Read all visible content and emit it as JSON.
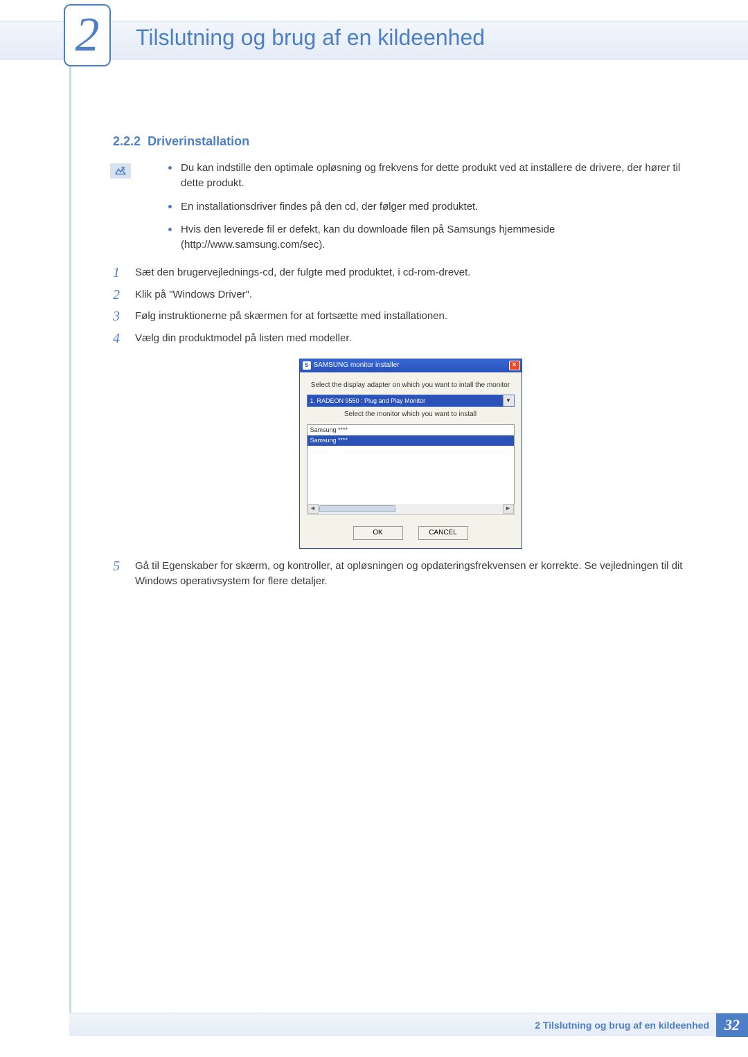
{
  "header": {
    "chapter_number": "2",
    "chapter_title": "Tilslutning og brug af en kildeenhed"
  },
  "section": {
    "number": "2.2.2",
    "title": "Driverinstallation"
  },
  "notes": {
    "items": [
      "Du kan indstille den optimale opløsning og frekvens for dette produkt ved at installere de drivere, der hører til dette produkt.",
      "En installationsdriver findes på den cd, der følger med produktet.",
      "Hvis den leverede fil er defekt, kan du downloade filen på Samsungs hjemmeside (http://www.samsung.com/sec)."
    ]
  },
  "steps": {
    "items": [
      {
        "num": "1",
        "text": "Sæt den brugervejlednings-cd, der fulgte med produktet, i cd-rom-drevet."
      },
      {
        "num": "2",
        "text": "Klik på \"Windows Driver\"."
      },
      {
        "num": "3",
        "text": "Følg instruktionerne på skærmen for at fortsætte med installationen."
      },
      {
        "num": "4",
        "text": "Vælg din produktmodel på listen med modeller."
      },
      {
        "num": "5",
        "text": "Gå til Egenskaber for skærm, og kontroller, at opløsningen og opdateringsfrekvensen er korrekte. Se vejledningen til dit Windows operativsystem for flere detaljer."
      }
    ]
  },
  "installer": {
    "title": "SAMSUNG monitor installer",
    "label1": "Select the display adapter on which you want to intall the monitor",
    "adapter": "1. RADEON 9550 : Plug and Play Monitor",
    "label2": "Select the monitor which you want to install",
    "list_row1": "Samsung ****",
    "list_row_selected": "Samsung ****",
    "ok_label": "OK",
    "cancel_label": "CANCEL"
  },
  "footer": {
    "text": "2 Tilslutning og brug af en kildeenhed",
    "page": "32"
  }
}
